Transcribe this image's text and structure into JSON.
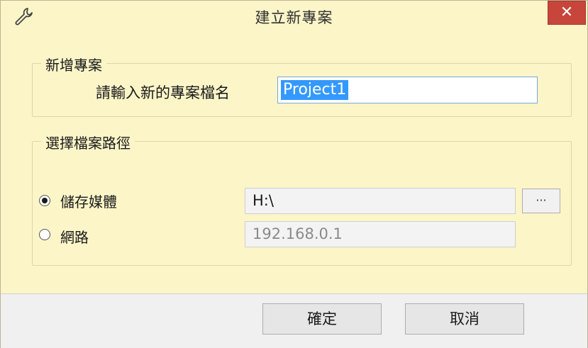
{
  "window": {
    "title": "建立新專案",
    "close_label": "✕"
  },
  "new_project": {
    "group_label": "新增專案",
    "prompt": "請輸入新的專案檔名",
    "name_value": "Project1"
  },
  "path": {
    "group_label": "選擇檔案路徑",
    "options": [
      {
        "label": "儲存媒體",
        "selected": true,
        "value": "H:\\"
      },
      {
        "label": "網路",
        "selected": false,
        "value": "192.168.0.1"
      }
    ],
    "browse_label": "···"
  },
  "buttons": {
    "ok": "確定",
    "cancel": "取消"
  },
  "icons": {
    "title": "wrench-icon"
  }
}
